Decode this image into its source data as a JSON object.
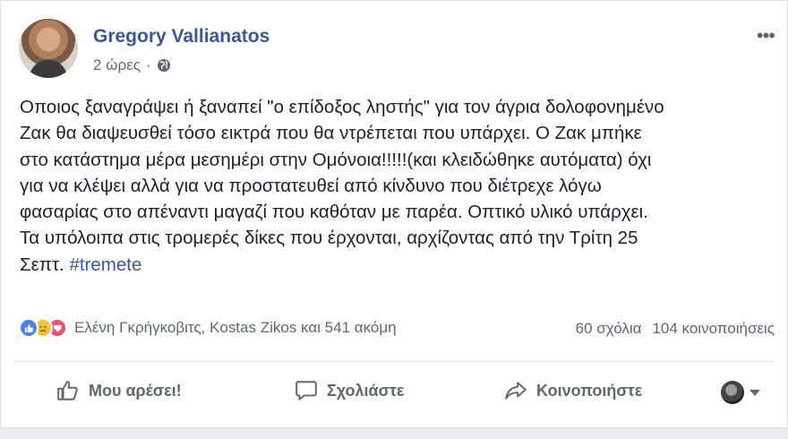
{
  "post": {
    "author": "Gregory Vallianatos",
    "time": "2 ώρες",
    "separator": "·",
    "more_icon": "•••",
    "lines": [
      "Οποιος ξαναγράψει ή ξαναπεί \"ο επίδοξος ληστής\" για τον άγρια δολοφονημένο",
      "Ζακ θα διαψευσθεί τόσο εικτρά που θα ντρέπεται που υπάρχει. Ο Ζακ μπήκε",
      "στο κατάστημα μέρα μεσημέρι στην Ομόνοια!!!!!(και κλειδώθηκε αυτόματα) όχι",
      "για να κλέψει αλλά για να προστατευθεί από κίνδυνο που διέτρεχε λόγω",
      "φασαρίας στο απέναντι μαγαζί που καθόταν με παρέα. Οπτικό υλικό υπάρχει.",
      "Τα υπόλοιπα στις τρομερές δίκες που έρχονται, αρχίζοντας από την Τρίτη 25"
    ],
    "last_line": "Σεπτ. ",
    "hashtag": "#tremete"
  },
  "reactions": {
    "icons": [
      "like-icon",
      "sad-icon",
      "love-icon"
    ],
    "names": "Ελένη Γκρήγκοβιτς, Kostas Zikos και 541 ακόμη",
    "comments": "60 σχόλια",
    "shares": "104 κοινοποιήσεις"
  },
  "actions": {
    "like": "Μου αρέσει!",
    "comment": "Σχολιάστε",
    "share": "Κοινοποιήστε"
  },
  "colors": {
    "link": "#385898",
    "secondary_text": "#606770",
    "like_blue": "#4a80f5",
    "love_red": "#f0506e",
    "sad_yellow": "#f5c33b"
  }
}
